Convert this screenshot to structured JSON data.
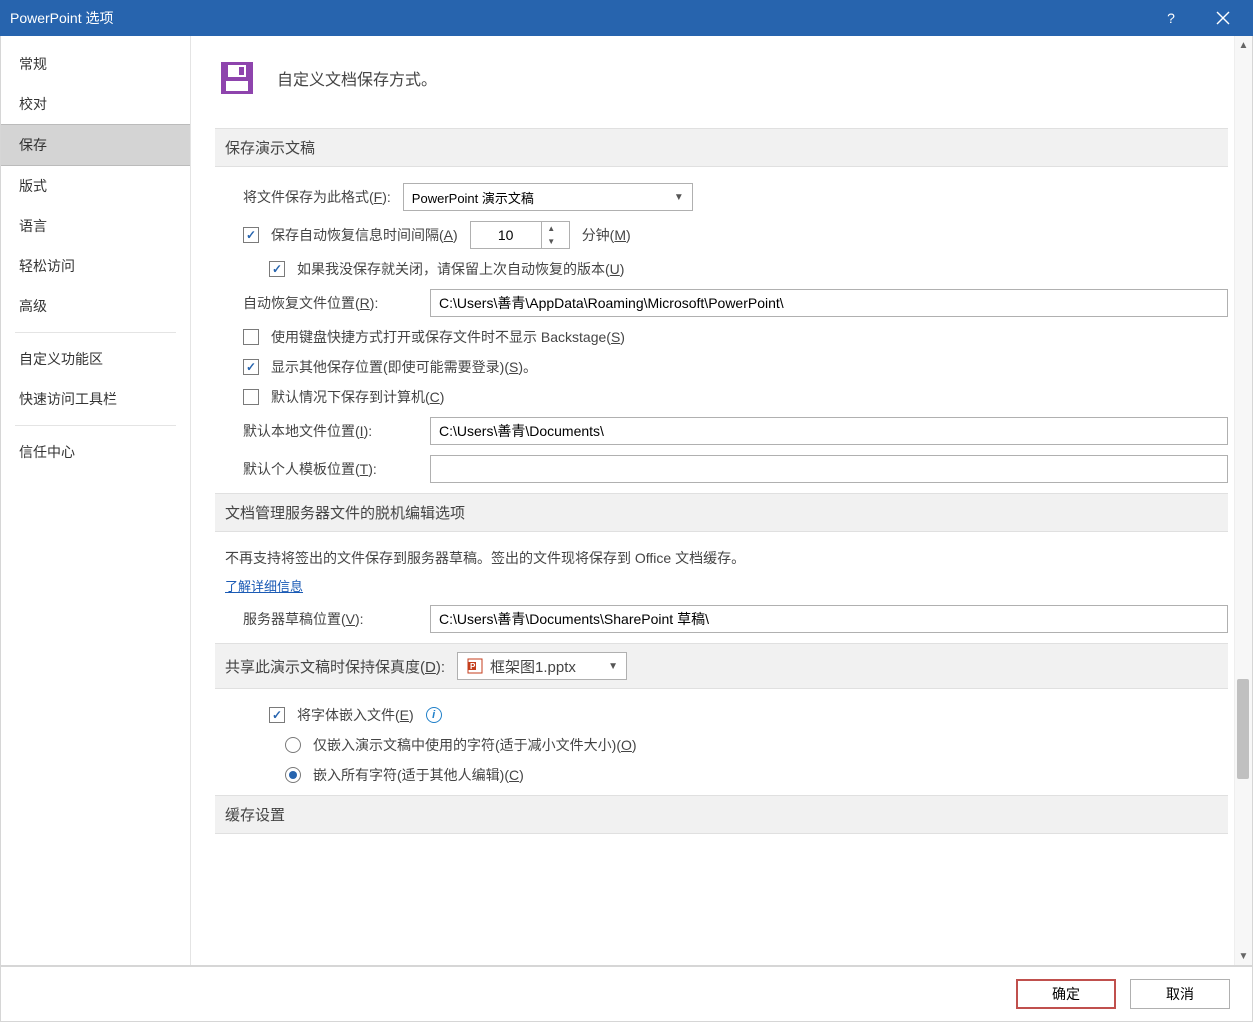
{
  "titlebar": {
    "title": "PowerPoint 选项"
  },
  "sidebar": {
    "items": [
      {
        "label": "常规"
      },
      {
        "label": "校对"
      },
      {
        "label": "保存",
        "selected": true
      },
      {
        "label": "版式"
      },
      {
        "label": "语言"
      },
      {
        "label": "轻松访问"
      },
      {
        "label": "高级"
      },
      {
        "label": "自定义功能区"
      },
      {
        "label": "快速访问工具栏"
      },
      {
        "label": "信任中心"
      }
    ]
  },
  "header": {
    "subtitle": "自定义文档保存方式。"
  },
  "sections": {
    "save_presentations": {
      "title": "保存演示文稿",
      "format_label": "将文件保存为此格式(F):",
      "format_value": "PowerPoint 演示文稿",
      "autorecover_label": "保存自动恢复信息时间间隔(A)",
      "autorecover_value": "10",
      "minutes_label": "分钟(M)",
      "keep_last_label": "如果我没保存就关闭，请保留上次自动恢复的版本(U)",
      "autorecover_loc_label": "自动恢复文件位置(R):",
      "autorecover_loc_value": "C:\\Users\\善青\\AppData\\Roaming\\Microsoft\\PowerPoint\\",
      "no_backstage_label": "使用键盘快捷方式打开或保存文件时不显示 Backstage(S)",
      "show_other_loc_label": "显示其他保存位置(即使可能需要登录)(S)。",
      "save_to_computer_label": "默认情况下保存到计算机(C)",
      "default_local_label": "默认本地文件位置(I):",
      "default_local_value": "C:\\Users\\善青\\Documents\\",
      "default_template_label": "默认个人模板位置(T):",
      "default_template_value": ""
    },
    "offline_editing": {
      "title": "文档管理服务器文件的脱机编辑选项",
      "note": "不再支持将签出的文件保存到服务器草稿。签出的文件现将保存到 Office 文档缓存。",
      "learn_more": "了解详细信息",
      "server_draft_label": "服务器草稿位置(V):",
      "server_draft_value": "C:\\Users\\善青\\Documents\\SharePoint 草稿\\"
    },
    "fidelity": {
      "title": "共享此演示文稿时保持保真度(D):",
      "file_value": "框架图1.pptx",
      "embed_fonts_label": "将字体嵌入文件(E)",
      "embed_used_label": "仅嵌入演示文稿中使用的字符(适于减小文件大小)(O)",
      "embed_all_label": "嵌入所有字符(适于其他人编辑)(C)"
    },
    "cache": {
      "title": "缓存设置"
    }
  },
  "footer": {
    "ok": "确定",
    "cancel": "取消"
  }
}
